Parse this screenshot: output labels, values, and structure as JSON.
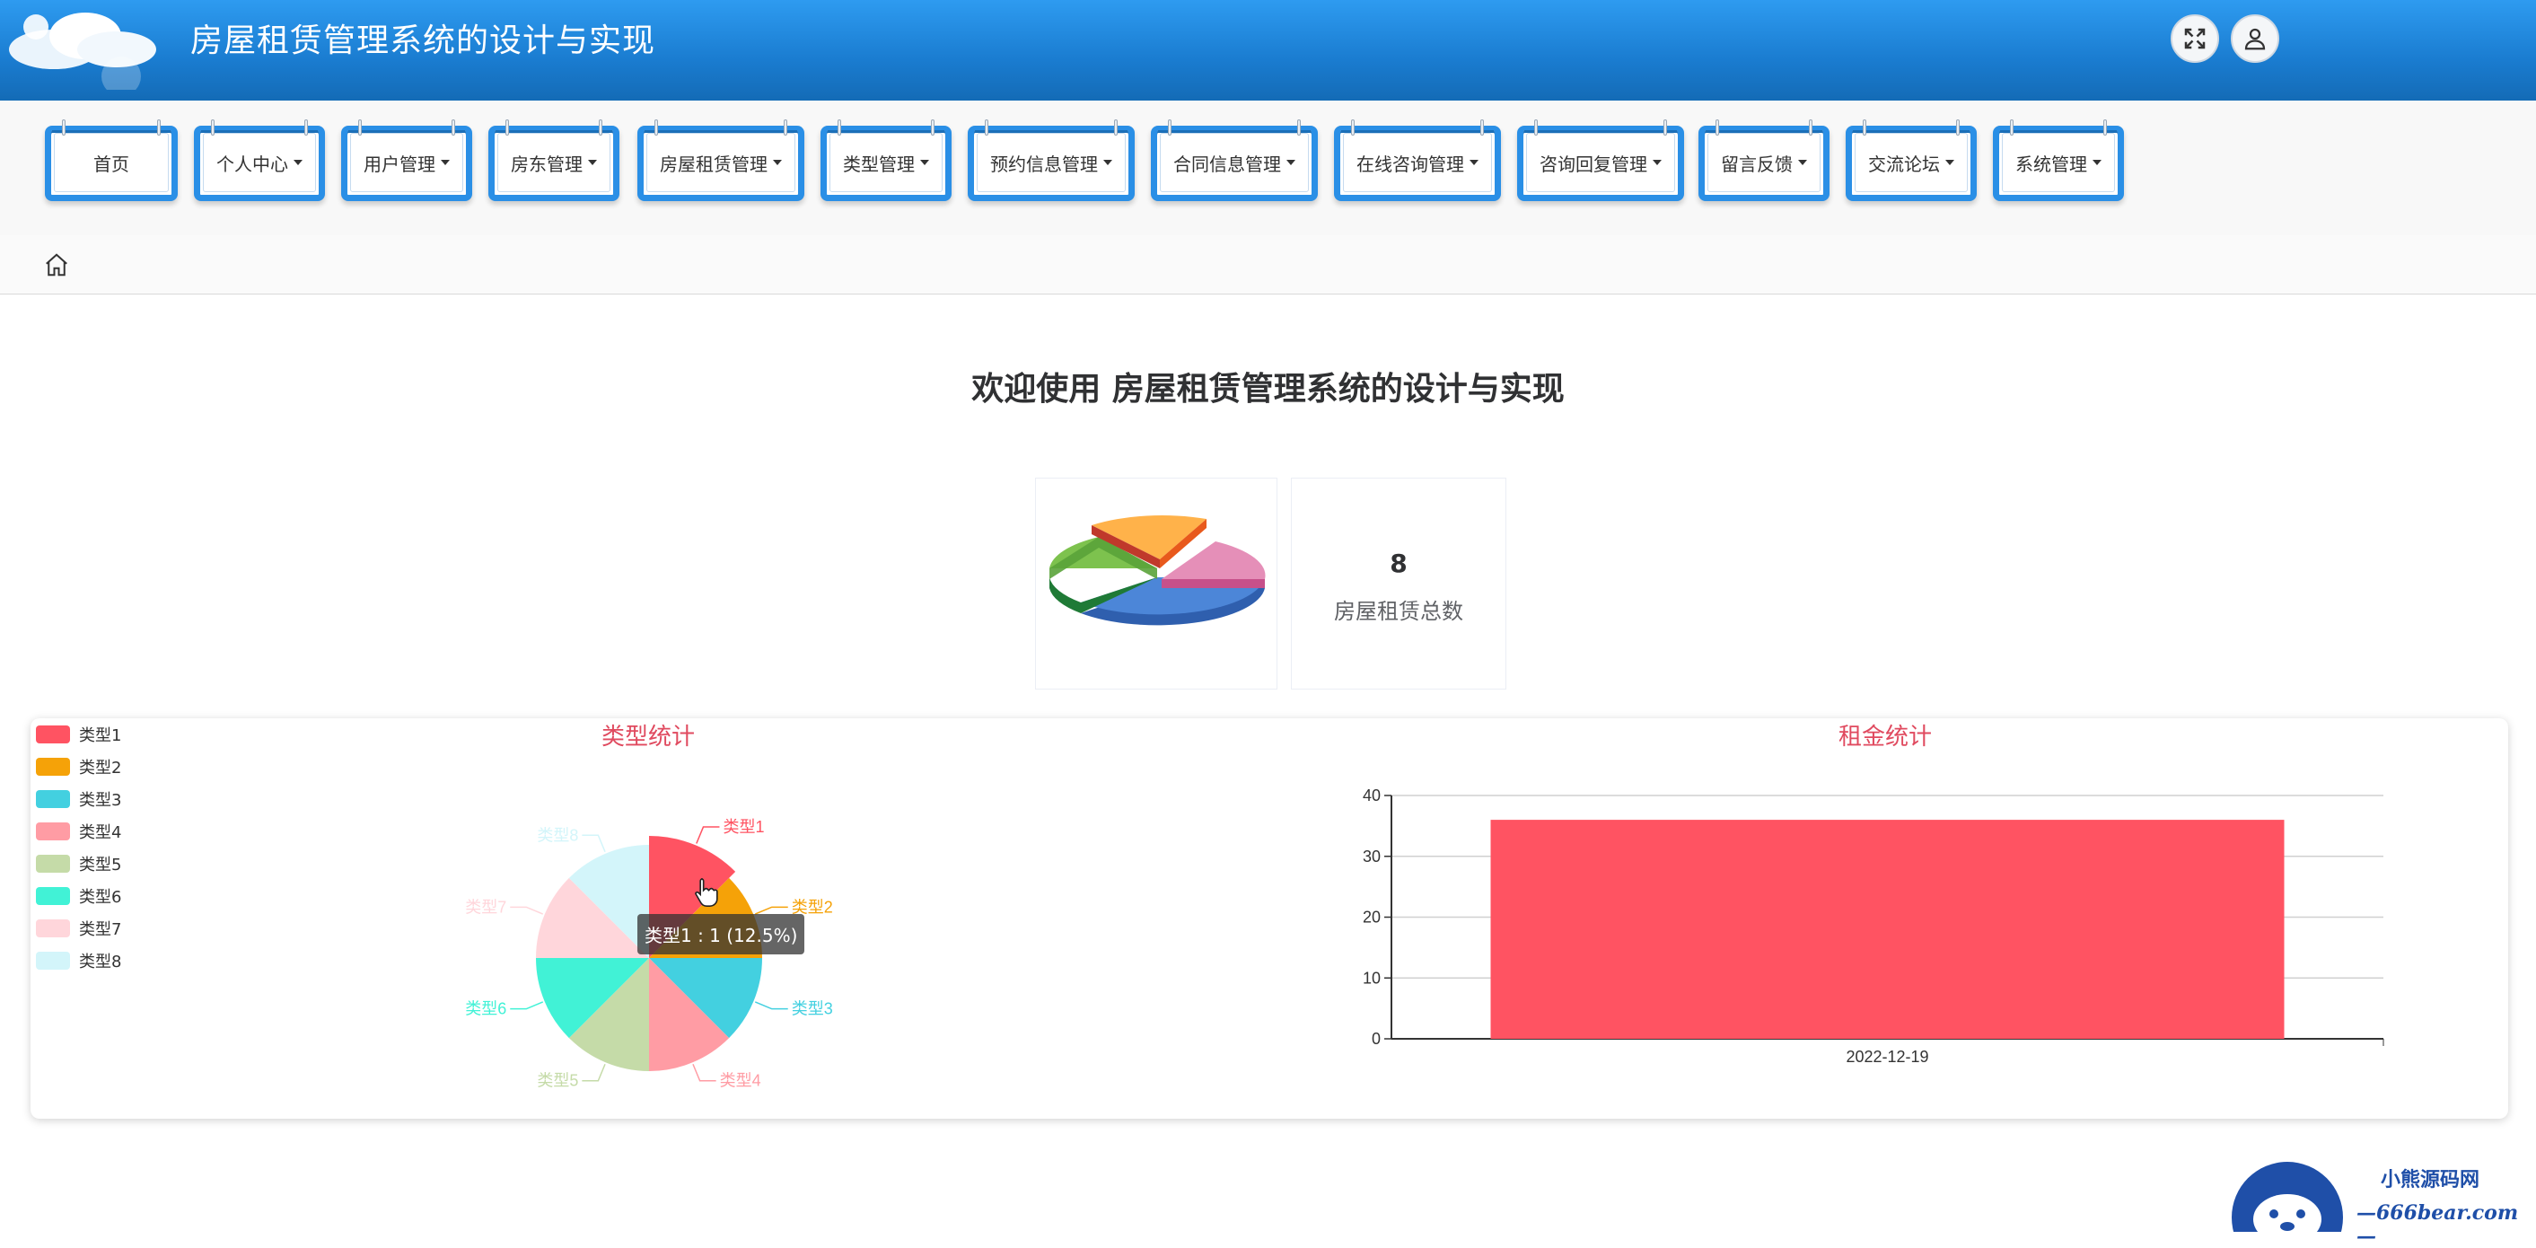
{
  "header": {
    "title": "房屋租赁管理系统的设计与实现",
    "fullscreen_icon": "expand-arrows-icon",
    "user_icon": "user-icon"
  },
  "nav": {
    "items": [
      {
        "label": "首页",
        "has_dropdown": false
      },
      {
        "label": "个人中心",
        "has_dropdown": true
      },
      {
        "label": "用户管理",
        "has_dropdown": true
      },
      {
        "label": "房东管理",
        "has_dropdown": true
      },
      {
        "label": "房屋租赁管理",
        "has_dropdown": true
      },
      {
        "label": "类型管理",
        "has_dropdown": true
      },
      {
        "label": "预约信息管理",
        "has_dropdown": true
      },
      {
        "label": "合同信息管理",
        "has_dropdown": true
      },
      {
        "label": "在线咨询管理",
        "has_dropdown": true
      },
      {
        "label": "咨询回复管理",
        "has_dropdown": true
      },
      {
        "label": "留言反馈",
        "has_dropdown": true
      },
      {
        "label": "交流论坛",
        "has_dropdown": true
      },
      {
        "label": "系统管理",
        "has_dropdown": true
      }
    ]
  },
  "breadcrumb": {
    "home_icon": "home-icon"
  },
  "welcome": {
    "text": "欢迎使用 房屋租赁管理系统的设计与实现"
  },
  "stats": {
    "value": "8",
    "label": "房屋租赁总数"
  },
  "charts": {
    "pie_title": "类型统计",
    "bar_title": "租金统计",
    "tooltip": "类型1 : 1 (12.5%)"
  },
  "chart_data": [
    {
      "type": "pie",
      "title": "类型统计",
      "categories": [
        "类型1",
        "类型2",
        "类型3",
        "类型4",
        "类型5",
        "类型6",
        "类型7",
        "类型8"
      ],
      "values": [
        1,
        1,
        1,
        1,
        1,
        1,
        1,
        1
      ],
      "colors": [
        "#ff5362",
        "#f5a208",
        "#43d0e0",
        "#ff9ca4",
        "#c5dba8",
        "#41f2d6",
        "#ffd6db",
        "#d3f5fa"
      ],
      "legend": "top-left"
    },
    {
      "type": "bar",
      "title": "租金统计",
      "categories": [
        "2022-12-19"
      ],
      "values": [
        36
      ],
      "yticks": [
        "0",
        "10",
        "20",
        "30",
        "40"
      ],
      "ylim": [
        0,
        40
      ],
      "color": "#ff5362",
      "grid": true
    }
  ],
  "watermark": {
    "line1": "小熊源码网",
    "line2": "—666bear.com—"
  }
}
